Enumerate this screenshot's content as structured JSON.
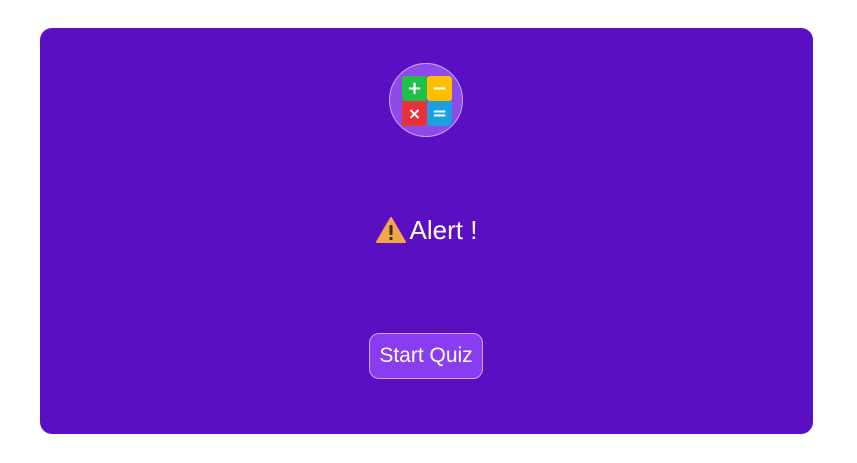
{
  "logo": {
    "icon": "calculator-operators-icon",
    "symbols": {
      "plus": "+",
      "minus": "−",
      "times": "×",
      "equals": "="
    },
    "colors": {
      "plus_bg": "#1fbf4a",
      "minus_bg": "#ffbf00",
      "times_bg": "#e8313a",
      "equals_bg": "#1b9fe0"
    }
  },
  "alert": {
    "icon": "warning-icon",
    "title": "Alert !"
  },
  "start_button": {
    "label": "Start Quiz"
  },
  "colors": {
    "card_bg": "#5b0fc2",
    "button_bg": "#8a3df0",
    "logo_circle_bg": "#8f4be8",
    "warning_fill": "#f2a64b"
  }
}
